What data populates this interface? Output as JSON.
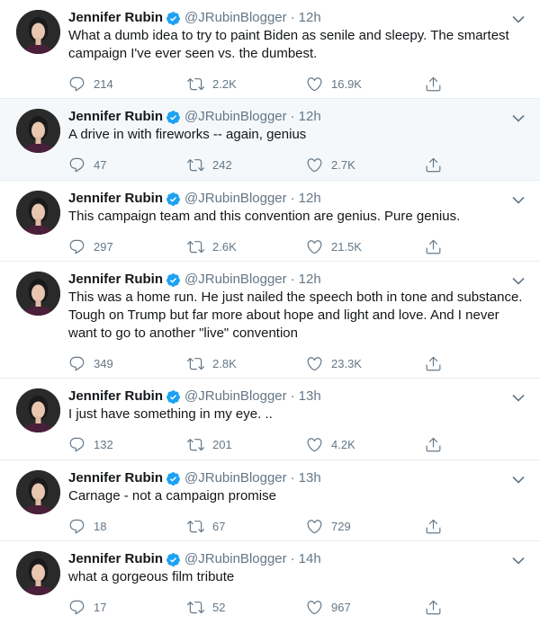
{
  "author": {
    "name": "Jennifer Rubin",
    "handle": "@JRubinBlogger",
    "separator": "·"
  },
  "icons": {
    "verified": "verified-badge-icon",
    "caret": "chevron-down-icon",
    "reply": "reply-icon",
    "retweet": "retweet-icon",
    "like": "heart-icon",
    "share": "share-icon"
  },
  "colors": {
    "verified": "#1da1f2",
    "muted": "#657786",
    "highlight": "#f5f8fa"
  },
  "tweets": [
    {
      "time": "12h",
      "text": "What a dumb idea to try to paint Biden as senile and sleepy. The smartest campaign I've ever seen vs. the dumbest.",
      "replies": "214",
      "retweets": "2.2K",
      "likes": "16.9K"
    },
    {
      "time": "12h",
      "text": "A drive in with fireworks -- again, genius",
      "replies": "47",
      "retweets": "242",
      "likes": "2.7K"
    },
    {
      "time": "12h",
      "text": "This campaign team and this convention are genius.  Pure genius.",
      "replies": "297",
      "retweets": "2.6K",
      "likes": "21.5K"
    },
    {
      "time": "12h",
      "text": "This was a home run. He just nailed the speech both in tone and substance. Tough on Trump but far more about hope and light and love. And I never want to go to another \"live\" convention",
      "replies": "349",
      "retweets": "2.8K",
      "likes": "23.3K"
    },
    {
      "time": "13h",
      "text": "I just have something in my eye. ..",
      "replies": "132",
      "retweets": "201",
      "likes": "4.2K"
    },
    {
      "time": "13h",
      "text": "Carnage - not a campaign promise",
      "replies": "18",
      "retweets": "67",
      "likes": "729"
    },
    {
      "time": "14h",
      "text": "what a gorgeous film tribute",
      "replies": "17",
      "retweets": "52",
      "likes": "967"
    }
  ]
}
